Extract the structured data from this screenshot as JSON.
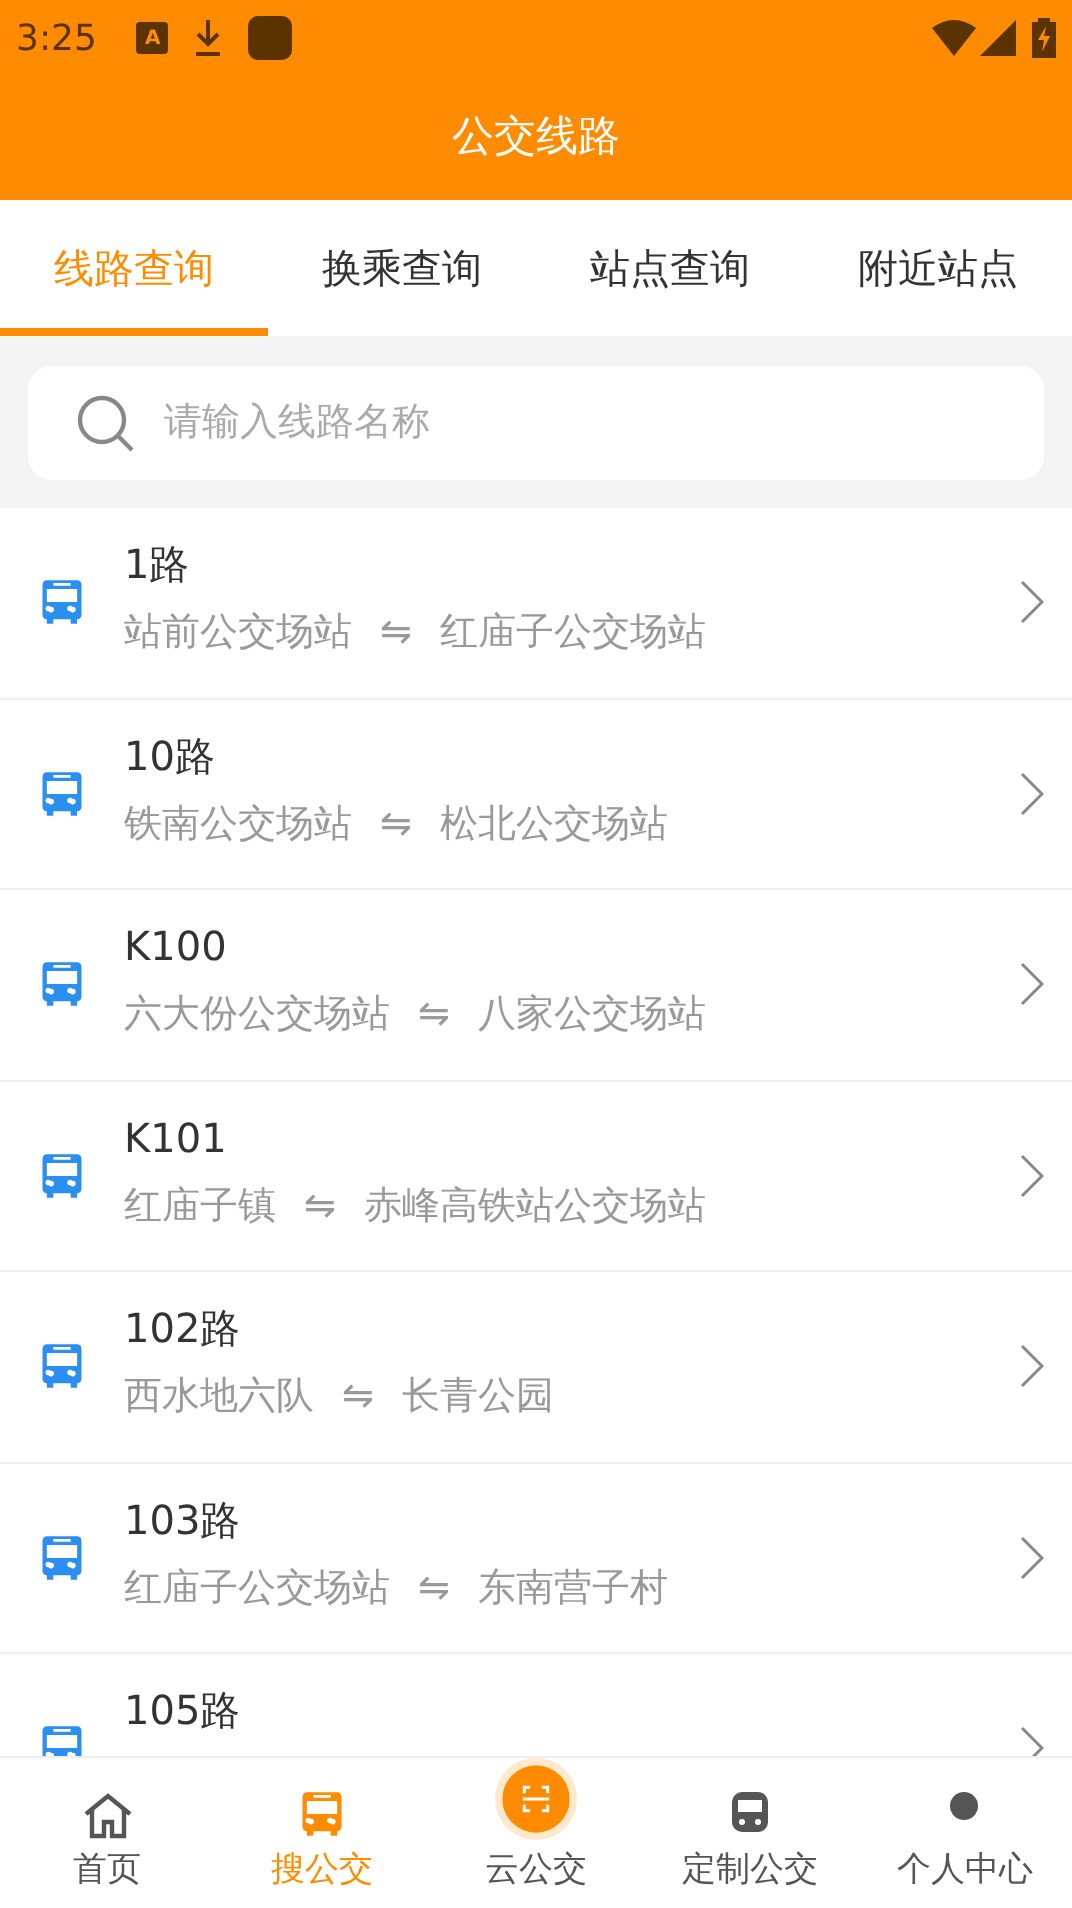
{
  "status_bar": {
    "time": "3:25",
    "notification_badge": "A"
  },
  "header": {
    "title": "公交线路"
  },
  "tabs": [
    {
      "label": "线路查询",
      "selected": true
    },
    {
      "label": "换乘查询",
      "selected": false
    },
    {
      "label": "站点查询",
      "selected": false
    },
    {
      "label": "附近站点",
      "selected": false
    }
  ],
  "search": {
    "placeholder": "请输入线路名称"
  },
  "routes": [
    {
      "name": "1路",
      "from": "站前公交场站",
      "arrow": "⇋",
      "to": "红庙子公交场站"
    },
    {
      "name": "10路",
      "from": "铁南公交场站",
      "arrow": "⇋",
      "to": "松北公交场站"
    },
    {
      "name": "K100",
      "from": "六大份公交场站",
      "arrow": "⇋",
      "to": "八家公交场站"
    },
    {
      "name": "K101",
      "from": "红庙子镇",
      "arrow": "⇋",
      "to": "赤峰高铁站公交场站"
    },
    {
      "name": "102路",
      "from": "西水地六队",
      "arrow": "⇋",
      "to": "长青公园"
    },
    {
      "name": "103路",
      "from": "红庙子公交场站",
      "arrow": "⇋",
      "to": "东南营子村"
    },
    {
      "name": "105路"
    }
  ],
  "bottom_nav": [
    {
      "label": "首页",
      "kind": "home",
      "selected": false
    },
    {
      "label": "搜公交",
      "kind": "bus",
      "selected": true
    },
    {
      "label": "云公交",
      "kind": "scan",
      "selected": false
    },
    {
      "label": "定制公交",
      "kind": "custom",
      "selected": false
    },
    {
      "label": "个人中心",
      "kind": "person",
      "selected": false
    }
  ]
}
